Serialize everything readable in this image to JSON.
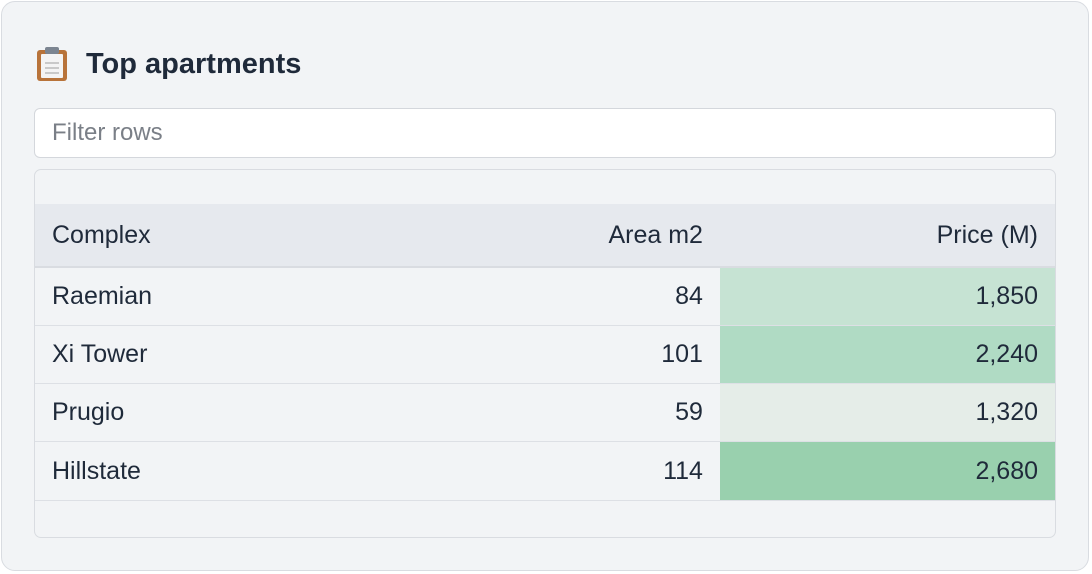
{
  "panel": {
    "icon": "clipboard-icon",
    "title": "Top apartments"
  },
  "filter": {
    "placeholder": "Filter rows",
    "value": ""
  },
  "table": {
    "headers": [
      "Complex",
      "Area m2",
      "Price (M)"
    ],
    "rows": [
      {
        "complex": "Raemian",
        "area": "84",
        "price": "1,850",
        "price_color": "#c6e3d3"
      },
      {
        "complex": "Xi Tower",
        "area": "101",
        "price": "2,240",
        "price_color": "#b0dbc4"
      },
      {
        "complex": "Prugio",
        "area": "59",
        "price": "1,320",
        "price_color": "#e5ede8"
      },
      {
        "complex": "Hillstate",
        "area": "114",
        "price": "2,680",
        "price_color": "#99d0ae"
      }
    ]
  },
  "colors": {
    "card_bg": "#f2f4f6",
    "header_bg": "#e6e9ee",
    "text": "#1f2a3a"
  }
}
